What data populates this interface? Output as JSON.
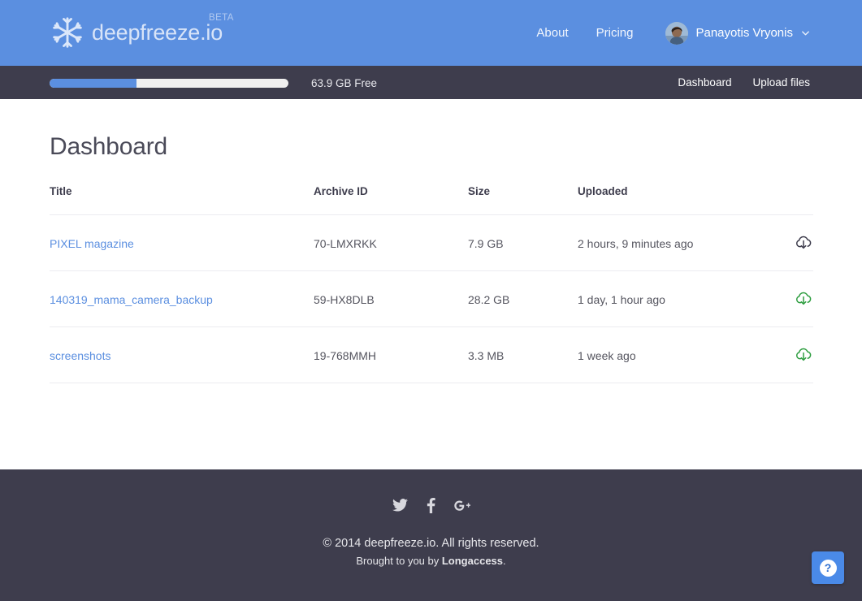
{
  "header": {
    "brand_name": "deepfreeze.io",
    "beta_label": "BETA",
    "logo_icon": "snowflake-icon",
    "nav": [
      {
        "label": "About"
      },
      {
        "label": "Pricing"
      }
    ],
    "user": {
      "name": "Panayotis Vryonis",
      "avatar_icon": "user-avatar-photo",
      "caret_icon": "chevron-down-icon"
    }
  },
  "subbar": {
    "storage": {
      "free_label": "63.9 GB Free",
      "used_percent": 36.4,
      "fill_color": "#5b8fe0",
      "track_color": "#f0f0f0"
    },
    "nav": [
      {
        "label": "Dashboard"
      },
      {
        "label": "Upload files"
      }
    ]
  },
  "main": {
    "title": "Dashboard",
    "table": {
      "columns": [
        "Title",
        "Archive ID",
        "Size",
        "Uploaded",
        ""
      ],
      "rows": [
        {
          "title": "PIXEL magazine",
          "archive_id": "70-LMXRKK",
          "size": "7.9 GB",
          "uploaded": "2 hours, 9 minutes ago",
          "download_icon": "cloud-download-icon",
          "download_color": "#3e3d4d"
        },
        {
          "title": "140319_mama_camera_backup",
          "archive_id": "59-HX8DLB",
          "size": "28.2 GB",
          "uploaded": "1 day, 1 hour ago",
          "download_icon": "cloud-download-icon",
          "download_color": "#2f9e41"
        },
        {
          "title": "screenshots",
          "archive_id": "19-768MMH",
          "size": "3.3 MB",
          "uploaded": "1 week ago",
          "download_icon": "cloud-download-icon",
          "download_color": "#2f9e41"
        }
      ]
    }
  },
  "footer": {
    "social": [
      {
        "name": "twitter-icon"
      },
      {
        "name": "facebook-icon"
      },
      {
        "name": "google-plus-icon"
      }
    ],
    "copyright": "© 2014 deepfreeze.io. All rights reserved.",
    "brought_prefix": "Brought to you by ",
    "brought_brand": "Longaccess",
    "brought_suffix": "."
  },
  "help": {
    "glyph": "?"
  },
  "colors": {
    "header_blue": "#5b8fe0",
    "dark": "#3e3d4d",
    "link_blue": "#5b8fe0",
    "green": "#2f9e41"
  }
}
